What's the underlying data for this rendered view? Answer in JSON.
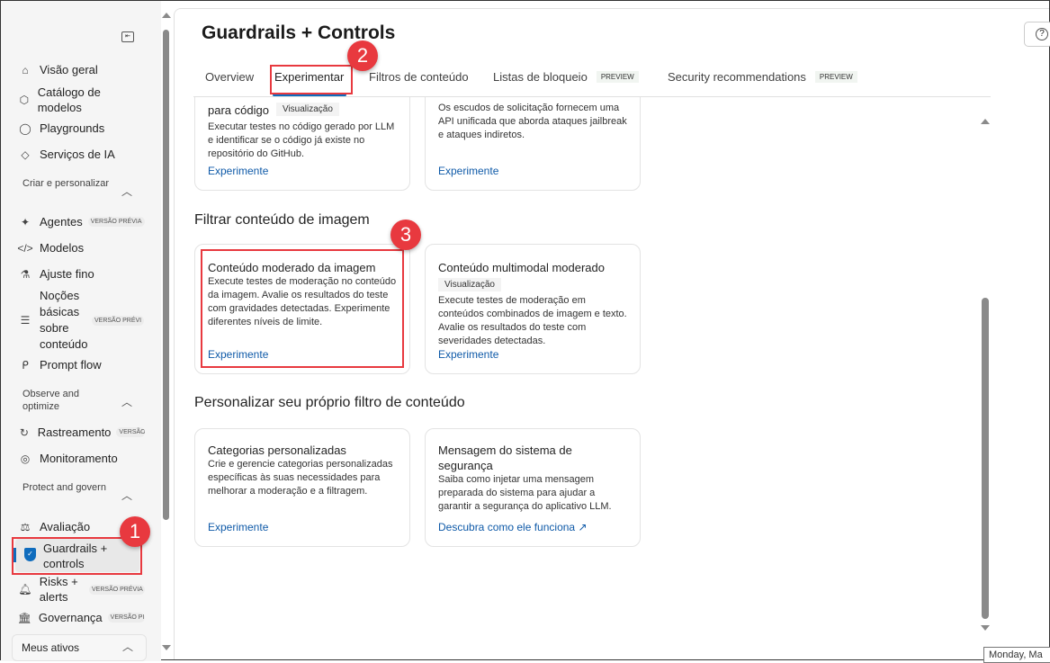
{
  "sidebar": {
    "items": [
      {
        "label": "Visão geral",
        "icon": "home-icon"
      },
      {
        "label": "Catálogo de modelos",
        "icon": "cube-icon"
      },
      {
        "label": "Playgrounds",
        "icon": "chat-icon"
      },
      {
        "label": "Serviços de IA",
        "icon": "ai-services-icon"
      },
      {
        "label": "Agentes",
        "badge": "VERSÃO PRÉVIA",
        "icon": "agent-icon"
      },
      {
        "label": "Modelos",
        "icon": "code-icon"
      },
      {
        "label": "Ajuste fino",
        "icon": "flask-icon"
      },
      {
        "label": "Noções básicas sobre conteúdo",
        "badge": "VERSÃO PRÉVI",
        "icon": "document-icon"
      },
      {
        "label": "Prompt flow",
        "icon": "flow-icon"
      },
      {
        "label": "Rastreamento",
        "badge": "VERSÃO",
        "icon": "trace-icon"
      },
      {
        "label": "Monitoramento",
        "icon": "monitor-icon"
      },
      {
        "label": "Avaliação",
        "icon": "scale-icon"
      },
      {
        "label": "Guardrails + controls",
        "icon": "shield-icon"
      },
      {
        "label": "Risks + alerts",
        "badge": "VERSÃO PRÉVIA",
        "icon": "alert-icon"
      },
      {
        "label": "Governança",
        "badge": "VERSÃO PI",
        "icon": "bank-icon"
      }
    ],
    "groups": [
      "Criar e personalizar",
      "Observe and optimize",
      "Protect and govern"
    ],
    "my_assets": "Meus ativos"
  },
  "header": {
    "title": "Guardrails + Controls"
  },
  "tabs": [
    {
      "label": "Overview"
    },
    {
      "label": "Experimentar",
      "selected": true
    },
    {
      "label": "Filtros de conteúdo"
    },
    {
      "label": "Listas de bloqueio",
      "badge": "PREVIEW"
    },
    {
      "label": "Security recommendations",
      "badge": "PREVIEW"
    }
  ],
  "top_cards": [
    {
      "title": "para código",
      "tag": "Visualização",
      "desc": "Executar testes no código gerado por LLM e identificar se o código já existe no repositório do GitHub.",
      "link": "Experimente"
    },
    {
      "desc_cut": "Os escudos de solicitação fornecem uma",
      "desc": "API unificada que aborda ataques jailbreak e ataques indiretos.",
      "link": "Experimente"
    }
  ],
  "sections": [
    {
      "title": "Filtrar conteúdo de imagem",
      "cards": [
        {
          "title": "Conteúdo moderado da imagem",
          "desc": "Execute testes de moderação no conteúdo da imagem. Avalie os resultados do teste com gravidades detectadas. Experimente diferentes níveis de limite.",
          "link": "Experimente"
        },
        {
          "title": "Conteúdo multimodal moderado",
          "tag": "Visualização",
          "desc": "Execute testes de moderação em conteúdos combinados de imagem e texto. Avalie os resultados do teste com severidades detectadas.",
          "link": "Experimente"
        }
      ]
    },
    {
      "title": "Personalizar seu próprio filtro de conteúdo",
      "cards": [
        {
          "title": "Categorias personalizadas",
          "desc": "Crie e gerencie categorias personalizadas específicas às suas necessidades para melhorar a moderação e a filtragem.",
          "link": "Experimente"
        },
        {
          "title": "Mensagem do sistema de segurança",
          "desc": "Saiba como injetar uma mensagem preparada do sistema para ajudar a garantir a segurança do aplicativo LLM.",
          "link": "Descubra como ele funciona"
        }
      ]
    }
  ],
  "annotations": [
    "1",
    "2",
    "3"
  ],
  "tooltip": "Monday, Ma",
  "help": "?"
}
